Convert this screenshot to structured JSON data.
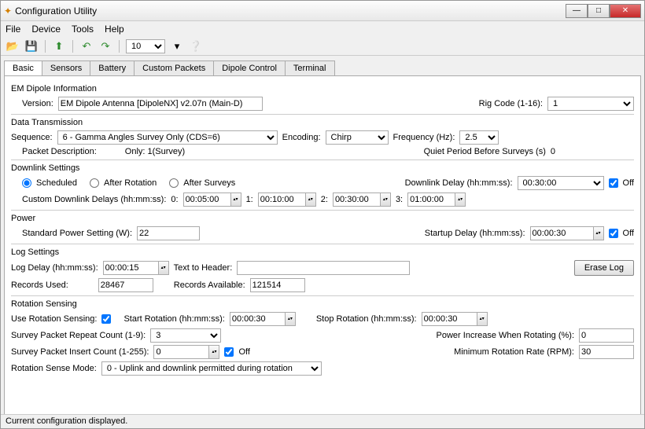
{
  "window": {
    "title": "Configuration Utility"
  },
  "menu": {
    "file": "File",
    "device": "Device",
    "tools": "Tools",
    "help": "Help"
  },
  "toolbar": {
    "zoom": "10"
  },
  "tabs": [
    "Basic",
    "Sensors",
    "Battery",
    "Custom Packets",
    "Dipole Control",
    "Terminal"
  ],
  "info": {
    "group": "EM Dipole Information",
    "version_label": "Version:",
    "version_value": "EM Dipole Antenna [DipoleNX] v2.07n (Main-D)",
    "rigcode_label": "Rig Code (1-16):",
    "rigcode_value": "1"
  },
  "trans": {
    "group": "Data Transmission",
    "seq_label": "Sequence:",
    "seq_value": "6 - Gamma Angles Survey Only (CDS=6)",
    "enc_label": "Encoding:",
    "enc_value": "Chirp",
    "freq_label": "Frequency (Hz):",
    "freq_value": "2.5",
    "pkt_desc_label": "Packet Description:",
    "pkt_desc_value": "Only: 1(Survey)",
    "quiet_label": "Quiet Period Before Surveys (s)",
    "quiet_value": "0"
  },
  "downlink": {
    "group": "Downlink Settings",
    "opt_scheduled": "Scheduled",
    "opt_after_rot": "After Rotation",
    "opt_after_surv": "After Surveys",
    "delay_label": "Downlink Delay (hh:mm:ss):",
    "delay_value": "00:30:00",
    "off": "Off",
    "custom_label": "Custom Downlink Delays (hh:mm:ss):",
    "d0l": "0:",
    "d0": "00:05:00",
    "d1l": "1:",
    "d1": "00:10:00",
    "d2l": "2:",
    "d2": "00:30:00",
    "d3l": "3:",
    "d3": "01:00:00"
  },
  "power": {
    "group": "Power",
    "std_label": "Standard Power Setting (W):",
    "std_value": "22",
    "startup_label": "Startup Delay (hh:mm:ss):",
    "startup_value": "00:00:30",
    "off": "Off"
  },
  "log": {
    "group": "Log Settings",
    "delay_label": "Log Delay (hh:mm:ss):",
    "delay_value": "00:00:15",
    "text_header_label": "Text to Header:",
    "text_header_value": "",
    "erase_btn": "Erase Log",
    "rec_used_label": "Records Used:",
    "rec_used_value": "28467",
    "rec_avail_label": "Records Available:",
    "rec_avail_value": "121514"
  },
  "rot": {
    "group": "Rotation Sensing",
    "use_label": "Use Rotation Sensing:",
    "start_label": "Start Rotation (hh:mm:ss):",
    "start_value": "00:00:30",
    "stop_label": "Stop Rotation (hh:mm:ss):",
    "stop_value": "00:00:30",
    "repeat_label": "Survey Packet Repeat Count (1-9):",
    "repeat_value": "3",
    "pinc_label": "Power Increase When Rotating (%):",
    "pinc_value": "0",
    "insert_label": "Survey Packet Insert Count (1-255):",
    "insert_value": "0",
    "off": "Off",
    "minrpm_label": "Minimum Rotation Rate (RPM):",
    "minrpm_value": "30",
    "mode_label": "Rotation Sense Mode:",
    "mode_value": "0 - Uplink and downlink permitted during rotation"
  },
  "status": "Current configuration displayed."
}
